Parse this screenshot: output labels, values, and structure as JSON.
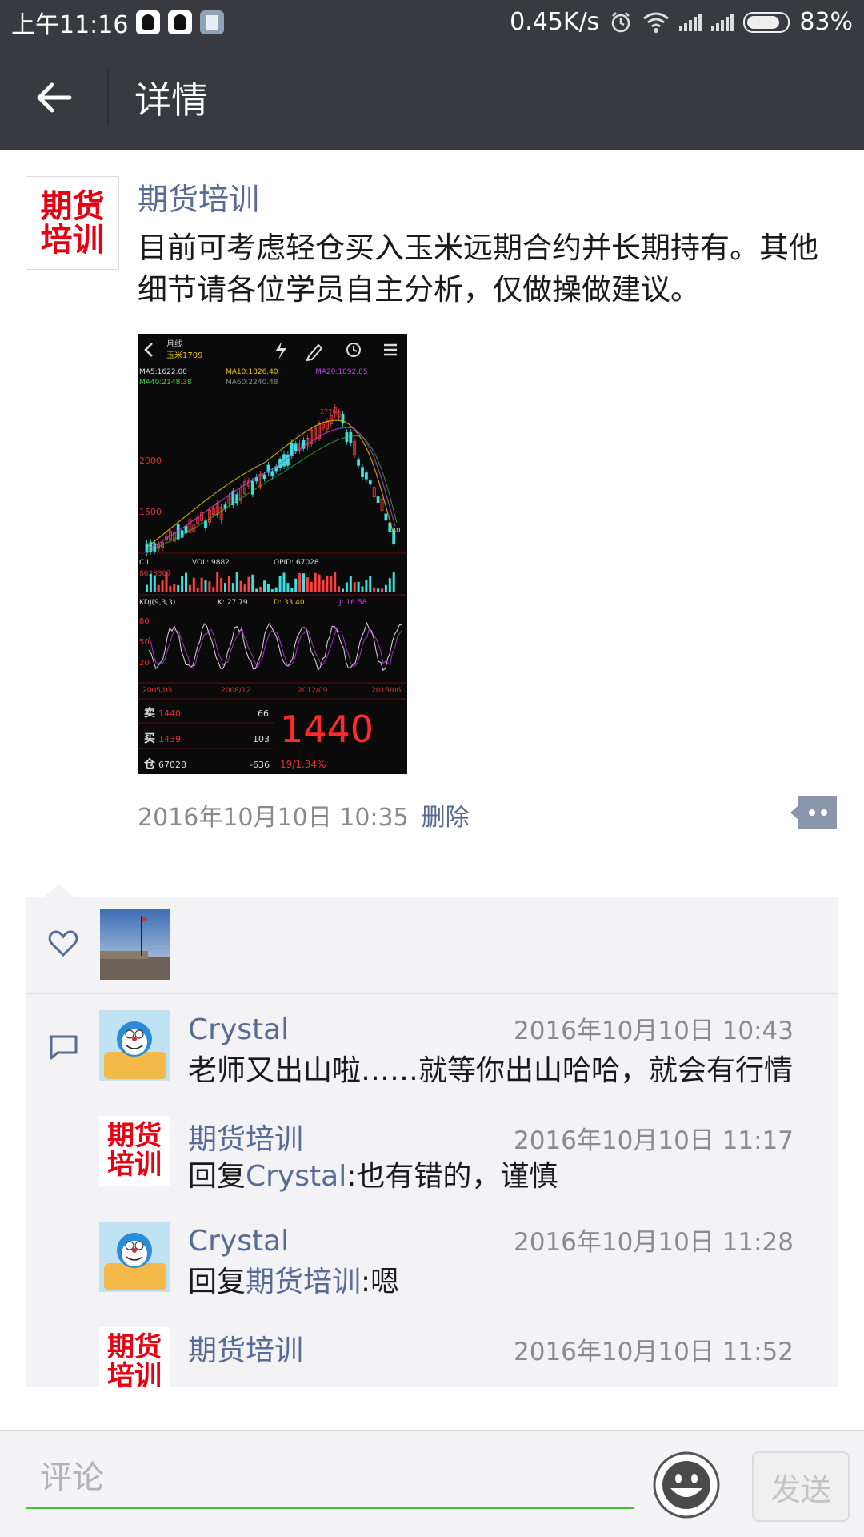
{
  "status_bar": {
    "time": "上午11:16",
    "speed": "0.45K/s",
    "battery": "83%",
    "icons": [
      "qq-icon",
      "qq-icon",
      "calculator-icon",
      "alarm-icon",
      "wifi-icon",
      "signal-icon",
      "signal-icon",
      "battery-icon"
    ]
  },
  "header": {
    "title": "详情",
    "back_icon": "arrow-left-icon"
  },
  "post": {
    "avatar_text_line1": "期货",
    "avatar_text_line2": "培训",
    "author": "期货培训",
    "text": "目前可考虑轻仓买入玉米远期合约并长期持有。其他细节请各位学员自主分析，仅做操做建议。",
    "image": {
      "title": "月线",
      "symbol": "玉米1709",
      "ma5": "MA5:1622.00",
      "ma10": "MA10:1826.40",
      "ma20": "MA20:1892.85",
      "ma40": "MA40:2148.38",
      "ma60": "MA60:2240.48",
      "peak_label": "2776",
      "y_2000": "2000",
      "y_1500": "1500",
      "low_label": "1440",
      "vol": "VOL: 9882",
      "opid": "OPID: 67028",
      "ci": "C.I.",
      "ci_val": "8623307",
      "kdj": "KDJ(9,3,3)",
      "k": "K: 27.79",
      "d": "D: 33.40",
      "j": "J: 16.58",
      "osc_80": "80",
      "osc_50": "50",
      "osc_20": "20",
      "date1": "2005/03",
      "date2": "2008/12",
      "date3": "2012/09",
      "date4": "2016/06",
      "sell_label": "卖",
      "sell_price": "1440",
      "sell_qty": "66",
      "buy_label": "买",
      "buy_price": "1439",
      "buy_qty": "103",
      "pos_label": "仓",
      "pos_val": "67028",
      "pos_chg": "-636",
      "last_price": "1440",
      "change": "19/1.34%"
    },
    "timestamp": "2016年10月10日 10:35",
    "delete_label": "删除",
    "more_icon": "comment-more-icon"
  },
  "likes": {
    "icon": "heart-icon"
  },
  "comments": [
    {
      "author": "Crystal",
      "time": "2016年10月10日 10:43",
      "prefix": "",
      "mention": "",
      "text": "老师又出山啦……就等你出山哈哈，就会有行情"
    },
    {
      "author": "期货培训",
      "time": "2016年10月10日 11:17",
      "prefix": "回复",
      "mention": "Crystal",
      "text": ":也有错的，谨慎"
    },
    {
      "author": "Crystal",
      "time": "2016年10月10日 11:28",
      "prefix": "回复",
      "mention": "期货培训",
      "text": ":嗯"
    },
    {
      "author": "期货培训",
      "time": "2016年10月10日 11:52",
      "prefix": "",
      "mention": "",
      "text": ""
    }
  ],
  "comment_bar": {
    "placeholder": "评论",
    "send_label": "发送",
    "emoji_icon": "smiley-icon"
  },
  "colors": {
    "header_bg": "#393a3f",
    "link": "#576b95",
    "logo_red": "#e60012",
    "input_underline": "#46c13c"
  }
}
